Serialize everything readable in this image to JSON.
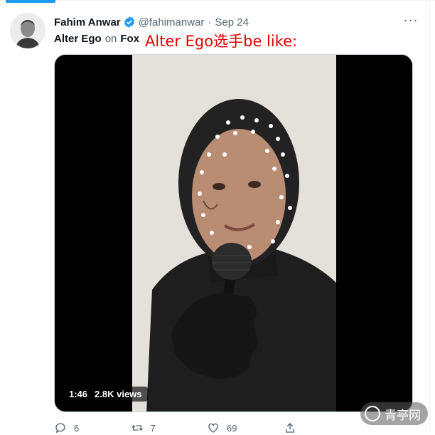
{
  "tweet": {
    "author_name": "Fahim Anwar",
    "handle": "@fahimanwar",
    "separator": "·",
    "date": "Sep 24",
    "more_label": "···",
    "context_show": "Alter Ego",
    "context_on": "on",
    "context_network": "Fox",
    "overlay_caption": "Alter Ego选手be like:",
    "media": {
      "duration": "1:46",
      "views": "2.8K views"
    },
    "actions": {
      "replies": "6",
      "retweets": "7",
      "likes": "69"
    }
  },
  "watermark": "青亭网",
  "colors": {
    "accent": "#1d9bf0",
    "secondary_text": "#536471",
    "caption_red": "#e00000"
  },
  "icons": [
    "verified-badge-icon",
    "more-icon",
    "reply-icon",
    "retweet-icon",
    "like-icon",
    "share-icon"
  ]
}
